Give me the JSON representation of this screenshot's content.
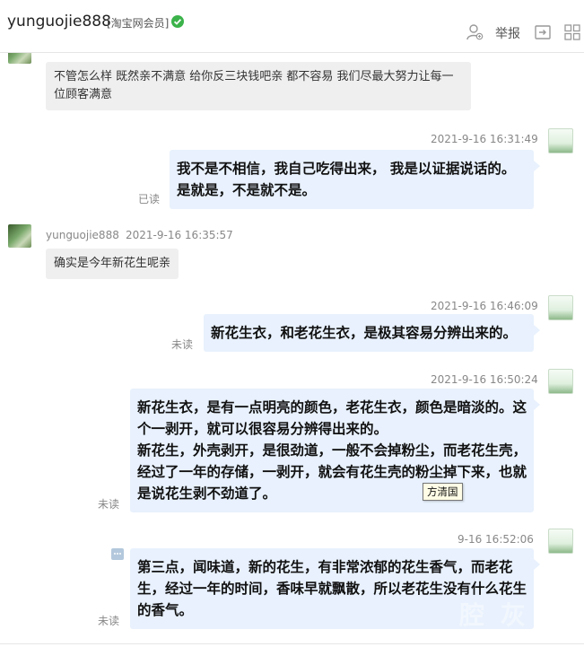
{
  "header": {
    "username": "yunguojie888",
    "member_tag": "[淘宝网会员]",
    "report_label": "举报"
  },
  "messages": [
    {
      "side": "left",
      "text": "不管怎么样  既然亲不满意  给你反三块钱吧亲  都不容易 我们尽最大努力让每一位顾客满意"
    },
    {
      "side": "right",
      "timestamp": "2021-9-16 16:31:49",
      "text": "我不是不相信，我自己吃得出来， 我是以证据说话的。是就是，不是就不是。",
      "status": "已读"
    },
    {
      "side": "left",
      "sender": "yunguojie888",
      "timestamp": "2021-9-16 16:35:57",
      "text": "确实是今年新花生呢亲"
    },
    {
      "side": "right",
      "timestamp": "2021-9-16 16:46:09",
      "text": "新花生衣，和老花生衣，是极其容易分辨出来的。",
      "status": "未读"
    },
    {
      "side": "right",
      "timestamp": "2021-9-16 16:50:24",
      "text": "新花生衣，是有一点明亮的颜色，老花生衣，颜色是暗淡的。这个一剥开，就可以很容易分辨得出来的。\n新花生，外壳剥开，是很劲道，一般不会掉粉尘，而老花生壳，经过了一年的存储，一剥开，就会有花生壳的粉尘掉下来，也就是说花生剥不劲道了。",
      "status": "未读"
    },
    {
      "side": "right",
      "timestamp": "9-16 16:52:06",
      "text": "第三点，闻味道，新的花生，有非常浓郁的花生香气，而老花生，经过一年的时间，香味早就飘散，所以老花生没有什么花生的香气。",
      "status": "未读"
    }
  ],
  "tooltip": "方清国",
  "watermark": "腔 灰",
  "colors": {
    "bubble_self": "#e8f1fd",
    "bubble_other": "#efefef",
    "verified": "#3bb34a",
    "meta_text": "#888888"
  },
  "icons": [
    "verified-check-icon",
    "add-contact-icon",
    "report-icon",
    "share-icon",
    "grid-icon",
    "quote-icon",
    "sprout-avatar",
    "user-avatar"
  ]
}
